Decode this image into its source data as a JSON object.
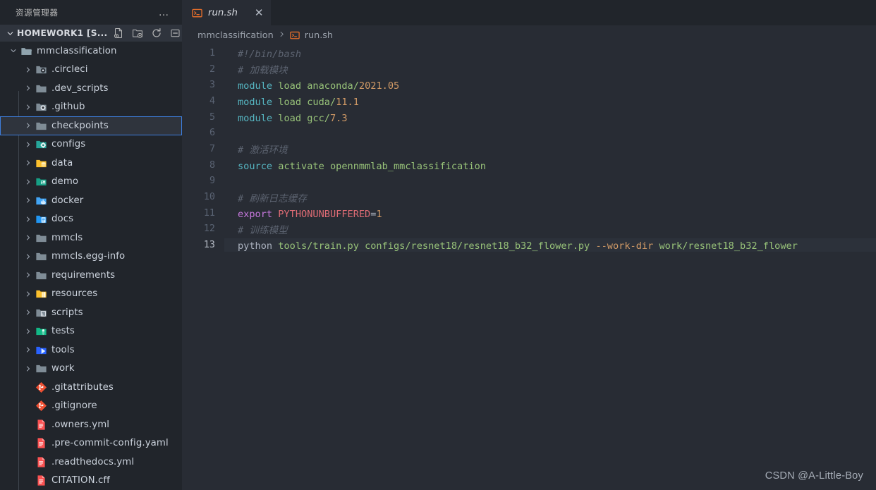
{
  "sidebar": {
    "panel_title": "资源管理器",
    "more_actions_label": "…",
    "root": {
      "label": "HOMEWORK1 [S...",
      "actions": [
        {
          "name": "new-file-icon",
          "tooltip": "New File"
        },
        {
          "name": "new-folder-icon",
          "tooltip": "New Folder"
        },
        {
          "name": "refresh-icon",
          "tooltip": "Refresh Explorer"
        },
        {
          "name": "collapse-all-icon",
          "tooltip": "Collapse Folders in Explorer"
        }
      ]
    },
    "tree": [
      {
        "label": "mmclassification",
        "type": "folder",
        "expanded": true,
        "depth": 1,
        "icon": "folder-open-icon",
        "color": "#90a4ae",
        "selected": false
      },
      {
        "label": ".circleci",
        "type": "folder",
        "expanded": false,
        "depth": 2,
        "icon": "folder-circleci-icon",
        "color": "#7f8c96",
        "selected": false
      },
      {
        "label": ".dev_scripts",
        "type": "folder",
        "expanded": false,
        "depth": 2,
        "icon": "folder-icon",
        "color": "#7f8c96",
        "selected": false
      },
      {
        "label": ".github",
        "type": "folder",
        "expanded": false,
        "depth": 2,
        "icon": "folder-github-icon",
        "color": "#7f8c96",
        "selected": false
      },
      {
        "label": "checkpoints",
        "type": "folder",
        "expanded": false,
        "depth": 2,
        "icon": "folder-icon",
        "color": "#7f8c96",
        "selected": true
      },
      {
        "label": "configs",
        "type": "folder",
        "expanded": false,
        "depth": 2,
        "icon": "folder-config-icon",
        "color": "#26a69a",
        "selected": false
      },
      {
        "label": "data",
        "type": "folder",
        "expanded": false,
        "depth": 2,
        "icon": "folder-data-icon",
        "color": "#fbc02d",
        "selected": false
      },
      {
        "label": "demo",
        "type": "folder",
        "expanded": false,
        "depth": 2,
        "icon": "folder-demo-icon",
        "color": "#16a085",
        "selected": false
      },
      {
        "label": "docker",
        "type": "folder",
        "expanded": false,
        "depth": 2,
        "icon": "folder-docker-icon",
        "color": "#42a5f5",
        "selected": false
      },
      {
        "label": "docs",
        "type": "folder",
        "expanded": false,
        "depth": 2,
        "icon": "folder-docs-icon",
        "color": "#2196f3",
        "selected": false
      },
      {
        "label": "mmcls",
        "type": "folder",
        "expanded": false,
        "depth": 2,
        "icon": "folder-icon",
        "color": "#7f8c96",
        "selected": false
      },
      {
        "label": "mmcls.egg-info",
        "type": "folder",
        "expanded": false,
        "depth": 2,
        "icon": "folder-icon",
        "color": "#7f8c96",
        "selected": false
      },
      {
        "label": "requirements",
        "type": "folder",
        "expanded": false,
        "depth": 2,
        "icon": "folder-icon",
        "color": "#7f8c96",
        "selected": false
      },
      {
        "label": "resources",
        "type": "folder",
        "expanded": false,
        "depth": 2,
        "icon": "folder-resource-icon",
        "color": "#fbc02d",
        "selected": false
      },
      {
        "label": "scripts",
        "type": "folder",
        "expanded": false,
        "depth": 2,
        "icon": "folder-scripts-icon",
        "color": "#7f8c96",
        "selected": false
      },
      {
        "label": "tests",
        "type": "folder",
        "expanded": false,
        "depth": 2,
        "icon": "folder-test-icon",
        "color": "#12b886",
        "selected": false
      },
      {
        "label": "tools",
        "type": "folder",
        "expanded": false,
        "depth": 2,
        "icon": "folder-tools-icon",
        "color": "#2962ff",
        "selected": false
      },
      {
        "label": "work",
        "type": "folder",
        "expanded": false,
        "depth": 2,
        "icon": "folder-icon",
        "color": "#7f8c96",
        "selected": false
      },
      {
        "label": ".gitattributes",
        "type": "file",
        "expanded": false,
        "depth": 2,
        "icon": "git-icon",
        "color": "#f05133",
        "selected": false
      },
      {
        "label": ".gitignore",
        "type": "file",
        "expanded": false,
        "depth": 2,
        "icon": "git-icon",
        "color": "#f05133",
        "selected": false
      },
      {
        "label": ".owners.yml",
        "type": "file",
        "expanded": false,
        "depth": 2,
        "icon": "yaml-file-icon",
        "color": "#fb5252",
        "selected": false
      },
      {
        "label": ".pre-commit-config.yaml",
        "type": "file",
        "expanded": false,
        "depth": 2,
        "icon": "yaml-file-icon",
        "color": "#fb5252",
        "selected": false
      },
      {
        "label": ".readthedocs.yml",
        "type": "file",
        "expanded": false,
        "depth": 2,
        "icon": "yaml-file-icon",
        "color": "#fb5252",
        "selected": false
      },
      {
        "label": "CITATION.cff",
        "type": "file",
        "expanded": false,
        "depth": 2,
        "icon": "yaml-file-icon",
        "color": "#fb5252",
        "selected": false
      }
    ]
  },
  "editor": {
    "tab": {
      "label": "run.sh",
      "icon": "shell-script-icon",
      "close_label": "✕",
      "dirty": false
    },
    "breadcrumb": {
      "folder": "mmclassification",
      "separator": "❯",
      "file": "run.sh",
      "file_icon": "shell-script-icon"
    },
    "active_line": 13,
    "lines": [
      {
        "n": 1,
        "tokens": [
          {
            "t": "#!/bin/bash",
            "c": "comment"
          }
        ]
      },
      {
        "n": 2,
        "tokens": [
          {
            "t": "# 加载模块",
            "c": "comment"
          }
        ]
      },
      {
        "n": 3,
        "tokens": [
          {
            "t": "module",
            "c": "cyan"
          },
          {
            "t": " ",
            "c": "plain"
          },
          {
            "t": "load",
            "c": "str"
          },
          {
            "t": " ",
            "c": "plain"
          },
          {
            "t": "anaconda/",
            "c": "str"
          },
          {
            "t": "2021.05",
            "c": "num"
          }
        ]
      },
      {
        "n": 4,
        "tokens": [
          {
            "t": "module",
            "c": "cyan"
          },
          {
            "t": " ",
            "c": "plain"
          },
          {
            "t": "load",
            "c": "str"
          },
          {
            "t": " ",
            "c": "plain"
          },
          {
            "t": "cuda/",
            "c": "str"
          },
          {
            "t": "11.1",
            "c": "num"
          }
        ]
      },
      {
        "n": 5,
        "tokens": [
          {
            "t": "module",
            "c": "cyan"
          },
          {
            "t": " ",
            "c": "plain"
          },
          {
            "t": "load",
            "c": "str"
          },
          {
            "t": " ",
            "c": "plain"
          },
          {
            "t": "gcc/",
            "c": "str"
          },
          {
            "t": "7.3",
            "c": "num"
          }
        ]
      },
      {
        "n": 6,
        "tokens": []
      },
      {
        "n": 7,
        "tokens": [
          {
            "t": "# 激活环境",
            "c": "comment"
          }
        ]
      },
      {
        "n": 8,
        "tokens": [
          {
            "t": "source",
            "c": "cyan"
          },
          {
            "t": " ",
            "c": "plain"
          },
          {
            "t": "activate",
            "c": "str"
          },
          {
            "t": " ",
            "c": "plain"
          },
          {
            "t": "opennmmlab_mmclassification",
            "c": "str"
          }
        ]
      },
      {
        "n": 9,
        "tokens": []
      },
      {
        "n": 10,
        "tokens": [
          {
            "t": "# 刷新日志缓存",
            "c": "comment"
          }
        ]
      },
      {
        "n": 11,
        "tokens": [
          {
            "t": "export",
            "c": "kw"
          },
          {
            "t": " ",
            "c": "plain"
          },
          {
            "t": "PYTHONUNBUFFERED",
            "c": "var"
          },
          {
            "t": "=",
            "c": "plain"
          },
          {
            "t": "1",
            "c": "num"
          }
        ]
      },
      {
        "n": 12,
        "tokens": [
          {
            "t": "# 训练模型",
            "c": "comment"
          }
        ]
      },
      {
        "n": 13,
        "tokens": [
          {
            "t": "python",
            "c": "plain"
          },
          {
            "t": " ",
            "c": "plain"
          },
          {
            "t": "tools/train.py",
            "c": "str"
          },
          {
            "t": " ",
            "c": "plain"
          },
          {
            "t": "configs/resnet18/resnet18_b32_flower.py",
            "c": "str"
          },
          {
            "t": " ",
            "c": "plain"
          },
          {
            "t": "--work-dir",
            "c": "param"
          },
          {
            "t": " ",
            "c": "plain"
          },
          {
            "t": "work/resnet18_b32_flower",
            "c": "str"
          }
        ]
      }
    ]
  },
  "watermark": "CSDN @A-Little-Boy",
  "colors": {
    "sidebar_bg": "#21252b",
    "editor_bg": "#282c34",
    "selection_border": "#3e7ede",
    "active_line_bg": "#2c313a",
    "comment": "#5c6370",
    "string": "#98c379",
    "number": "#d19a66",
    "keyword": "#c678dd",
    "variable": "#e06c75",
    "cyan": "#56b6c2",
    "plain": "#abb2bf"
  }
}
